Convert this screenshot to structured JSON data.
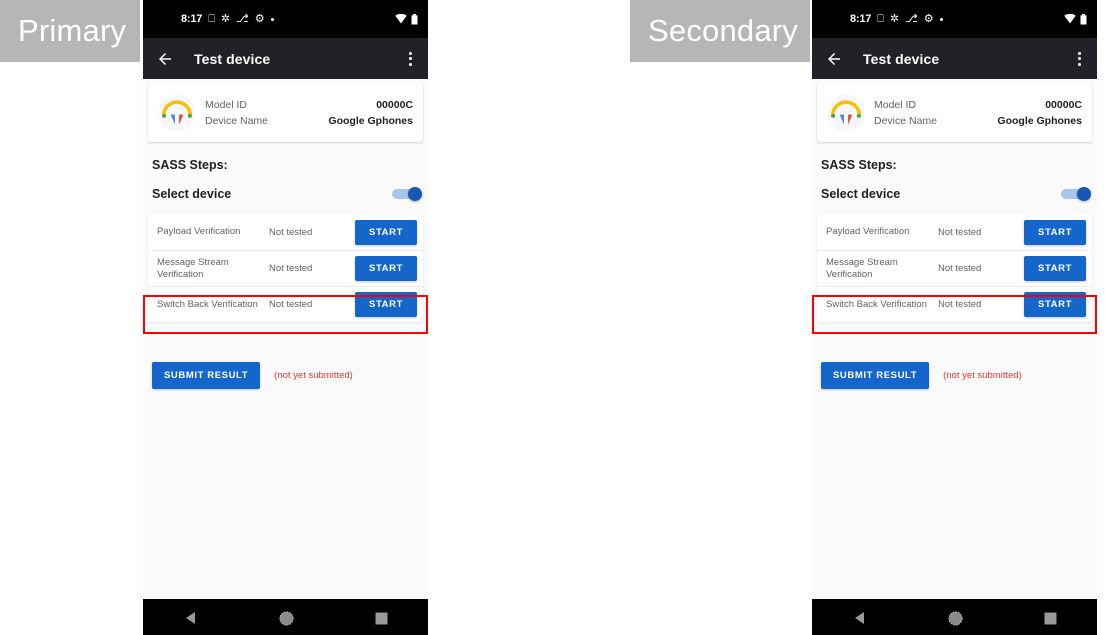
{
  "annotations": {
    "primary_label": "Primary",
    "secondary_label": "Secondary",
    "highlight_color": "#ff0000",
    "label_bg_color": "#b6b6b6"
  },
  "phone": {
    "status_bar": {
      "clock": "8:17",
      "icons": [
        "sim-icon",
        "brightness-icon",
        "bluetooth-icon",
        "settings-gear-icon",
        "dot-icon"
      ],
      "right_icons": [
        "wifi-icon",
        "battery-icon"
      ]
    },
    "app_bar": {
      "back_icon": "back-arrow-icon",
      "title": "Test device",
      "overflow_icon": "overflow-menu-icon"
    },
    "device_card": {
      "icon": "headphones-icon",
      "rows": [
        {
          "key": "Model ID",
          "value": "00000C"
        },
        {
          "key": "Device Name",
          "value": "Google Gphones"
        }
      ]
    },
    "section_title": "SASS Steps:",
    "select_device": {
      "label": "Select device",
      "toggle_state": "on",
      "toggle_color": "#1a56b4"
    },
    "steps": [
      {
        "name": "Payload Verification",
        "status": "Not tested",
        "action": "START"
      },
      {
        "name": "Message Stream Verification",
        "status": "Not tested",
        "action": "START"
      },
      {
        "name": "Switch Back Verification",
        "status": "Not tested",
        "action": "START"
      }
    ],
    "submit": {
      "button_label": "SUBMIT RESULT",
      "note": "(not yet submitted)",
      "note_color": "#e53935",
      "button_color": "#1466ca"
    },
    "nav_bar": {
      "back": "nav-back-icon",
      "home": "nav-home-icon",
      "recents": "nav-recents-icon"
    }
  }
}
